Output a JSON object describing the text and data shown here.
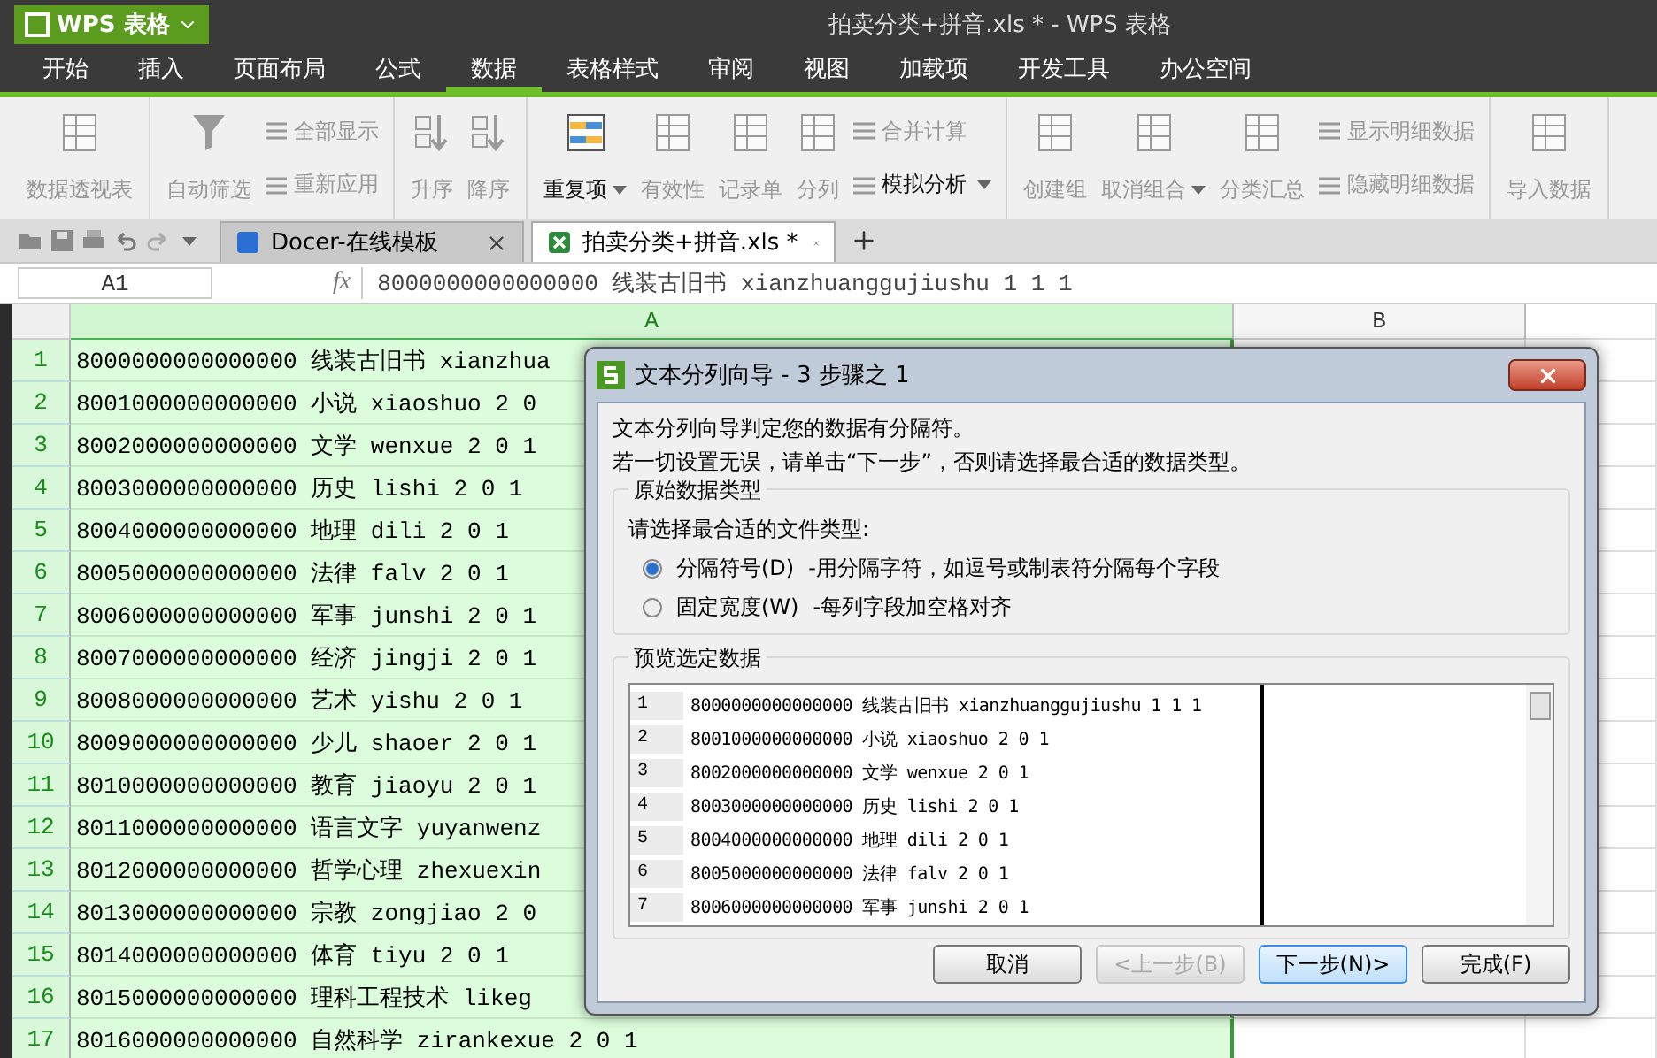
{
  "app": {
    "name": "WPS 表格"
  },
  "window": {
    "title": "拍卖分类+拼音.xls * - WPS 表格"
  },
  "menu_tabs": [
    {
      "label": "开始",
      "selected": false
    },
    {
      "label": "插入",
      "selected": false
    },
    {
      "label": "页面布局",
      "selected": false
    },
    {
      "label": "公式",
      "selected": false
    },
    {
      "label": "数据",
      "selected": true
    },
    {
      "label": "表格样式",
      "selected": false
    },
    {
      "label": "审阅",
      "selected": false
    },
    {
      "label": "视图",
      "selected": false
    },
    {
      "label": "加载项",
      "selected": false
    },
    {
      "label": "开发工具",
      "selected": false
    },
    {
      "label": "办公空间",
      "selected": false
    }
  ],
  "ribbon": [
    {
      "items": [
        {
          "kind": "large",
          "label": "数据透视表",
          "disabled": true
        }
      ]
    },
    {
      "items": [
        {
          "kind": "large",
          "label": "自动筛选",
          "disabled": true
        },
        {
          "kind": "small",
          "entries": [
            {
              "label": "全部显示",
              "disabled": true
            },
            {
              "label": "重新应用",
              "disabled": true
            }
          ]
        }
      ]
    },
    {
      "items": [
        {
          "kind": "large",
          "label": "升序",
          "disabled": true
        },
        {
          "kind": "large",
          "label": "降序",
          "disabled": true
        }
      ]
    },
    {
      "items": [
        {
          "kind": "large",
          "label": "重复项",
          "disabled": false,
          "dropdown": true
        },
        {
          "kind": "large",
          "label": "有效性",
          "disabled": true
        },
        {
          "kind": "large",
          "label": "记录单",
          "disabled": true
        },
        {
          "kind": "large",
          "label": "分列",
          "disabled": true
        },
        {
          "kind": "small",
          "entries": [
            {
              "label": "合并计算",
              "disabled": true
            },
            {
              "label": "模拟分析",
              "disabled": false,
              "dropdown": true
            }
          ]
        }
      ]
    },
    {
      "items": [
        {
          "kind": "large",
          "label": "创建组",
          "disabled": true
        },
        {
          "kind": "large",
          "label": "取消组合",
          "disabled": true,
          "dropdown": true
        },
        {
          "kind": "large",
          "label": "分类汇总",
          "disabled": true
        },
        {
          "kind": "small",
          "entries": [
            {
              "label": "显示明细数据",
              "disabled": true
            },
            {
              "label": "隐藏明细数据",
              "disabled": true
            }
          ]
        }
      ]
    },
    {
      "items": [
        {
          "kind": "large",
          "label": "导入数据",
          "disabled": true
        }
      ]
    }
  ],
  "doc_tabs": [
    {
      "label": "Docer-在线模板",
      "selected": false
    },
    {
      "label": "拍卖分类+拼音.xls *",
      "selected": true
    }
  ],
  "formula_bar": {
    "name_box": "A1",
    "fx": "fx",
    "value": "8000000000000000 线装古旧书 xianzhuanggujiushu 1 1 1"
  },
  "columns": [
    {
      "label": "A",
      "selected": true
    },
    {
      "label": "B",
      "selected": false
    }
  ],
  "rows": [
    {
      "number": "1",
      "text": "8000000000000000 线装古旧书 xianzhua"
    },
    {
      "number": "2",
      "text": "8001000000000000 小说 xiaoshuo 2 0"
    },
    {
      "number": "3",
      "text": "8002000000000000 文学 wenxue 2 0 1"
    },
    {
      "number": "4",
      "text": "8003000000000000 历史 lishi 2 0 1"
    },
    {
      "number": "5",
      "text": "8004000000000000 地理 dili 2 0 1"
    },
    {
      "number": "6",
      "text": "8005000000000000 法律 falv 2 0 1"
    },
    {
      "number": "7",
      "text": "8006000000000000 军事 junshi 2 0 1"
    },
    {
      "number": "8",
      "text": "8007000000000000 经济 jingji 2 0 1"
    },
    {
      "number": "9",
      "text": "8008000000000000 艺术 yishu 2 0 1"
    },
    {
      "number": "10",
      "text": "8009000000000000 少儿 shaoer 2 0 1"
    },
    {
      "number": "11",
      "text": "8010000000000000 教育 jiaoyu 2 0 1"
    },
    {
      "number": "12",
      "text": "8011000000000000 语言文字 yuyanwenz"
    },
    {
      "number": "13",
      "text": "8012000000000000 哲学心理 zhexuexin"
    },
    {
      "number": "14",
      "text": "8013000000000000 宗教 zongjiao 2 0"
    },
    {
      "number": "15",
      "text": "8014000000000000 体育 tiyu 2 0 1"
    },
    {
      "number": "16",
      "text": "8015000000000000 理科工程技术 likeg"
    },
    {
      "number": "17",
      "text": "8016000000000000 自然科学 zirankexue 2 0 1"
    }
  ],
  "dialog": {
    "title": "文本分列向导 - 3 步骤之 1",
    "intro": [
      "文本分列向导判定您的数据有分隔符。",
      "若一切设置无误，请单击“下一步”，否则请选择最合适的数据类型。"
    ],
    "type_group": {
      "legend": "原始数据类型",
      "prompt": "请选择最合适的文件类型:",
      "options": [
        {
          "label": "分隔符号(D)",
          "description": "-用分隔字符，如逗号或制表符分隔每个字段",
          "selected": true
        },
        {
          "label": "固定宽度(W)",
          "description": "-每列字段加空格对齐",
          "selected": false
        }
      ]
    },
    "preview": {
      "legend": "预览选定数据",
      "rows": [
        {
          "number": "1",
          "text": "8000000000000000 线装古旧书 xianzhuanggujiushu 1 1 1"
        },
        {
          "number": "2",
          "text": "8001000000000000 小说 xiaoshuo 2 0 1"
        },
        {
          "number": "3",
          "text": "8002000000000000 文学 wenxue 2 0 1"
        },
        {
          "number": "4",
          "text": "8003000000000000 历史 lishi 2 0 1"
        },
        {
          "number": "5",
          "text": "8004000000000000 地理 dili 2 0 1"
        },
        {
          "number": "6",
          "text": "8005000000000000 法律 falv 2 0 1"
        },
        {
          "number": "7",
          "text": "8006000000000000 军事 junshi 2 0 1"
        }
      ]
    },
    "buttons": [
      {
        "label": "取消",
        "disabled": false,
        "default": false
      },
      {
        "label": "<上一步(B)",
        "disabled": true,
        "default": false
      },
      {
        "label": "下一步(N)>",
        "disabled": false,
        "default": true
      },
      {
        "label": "完成(F)",
        "disabled": false,
        "default": false
      }
    ]
  }
}
